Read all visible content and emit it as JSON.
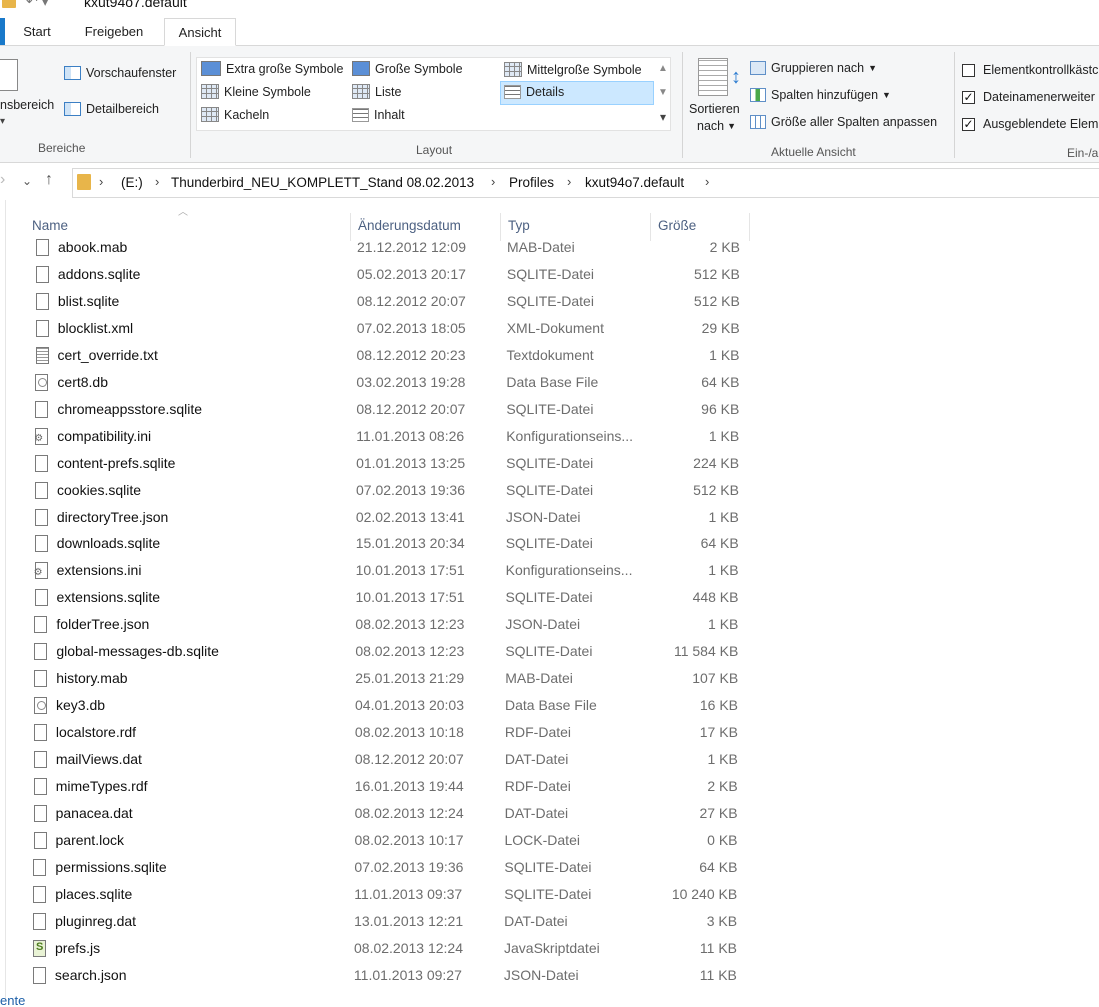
{
  "window": {
    "title": "kxut94o7.default",
    "quick_access": "↶  ▾"
  },
  "tabs": [
    {
      "label": "Start"
    },
    {
      "label": "Freigeben"
    },
    {
      "label": "Ansicht",
      "active": true
    }
  ],
  "ribbon": {
    "panes": {
      "nav_label": "nsbereich",
      "preview": "Vorschaufenster",
      "details": "Detailbereich",
      "group": "Bereiche"
    },
    "layout": {
      "items": [
        "Extra große Symbole",
        "Große Symbole",
        "Mittelgroße Symbole",
        "Kleine Symbole",
        "Liste",
        "Details",
        "Kacheln",
        "Inhalt"
      ],
      "selected": "Details",
      "group": "Layout"
    },
    "current_view": {
      "sort_line1": "Sortieren",
      "sort_line2": "nach",
      "group_by": "Gruppieren nach",
      "add_columns": "Spalten hinzufügen",
      "fit_columns": "Größe aller Spalten anpassen",
      "group": "Aktuelle Ansicht"
    },
    "show_hide": {
      "item_checkboxes": "Elementkontrollkästc",
      "file_extensions": "Dateinamenerweiter",
      "hidden_items": "Ausgeblendete Elem",
      "item_checkboxes_checked": false,
      "file_extensions_checked": true,
      "hidden_items_checked": true,
      "group": "Ein-/a"
    }
  },
  "address": {
    "crumbs": [
      "(E:)",
      "Thunderbird_NEU_KOMPLETT_Stand 08.02.2013",
      "Profiles",
      "kxut94o7.default"
    ]
  },
  "columns": {
    "name": "Name",
    "date": "Änderungsdatum",
    "type": "Typ",
    "size": "Größe"
  },
  "files": [
    {
      "name": "abook.mab",
      "date": "21.12.2012 12:09",
      "type": "MAB-Datei",
      "size": "2 KB",
      "icon": "file-icon"
    },
    {
      "name": "addons.sqlite",
      "date": "05.02.2013 20:17",
      "type": "SQLITE-Datei",
      "size": "512 KB",
      "icon": "file-icon"
    },
    {
      "name": "blist.sqlite",
      "date": "08.12.2012 20:07",
      "type": "SQLITE-Datei",
      "size": "512 KB",
      "icon": "file-icon"
    },
    {
      "name": "blocklist.xml",
      "date": "07.02.2013 18:05",
      "type": "XML-Dokument",
      "size": "29 KB",
      "icon": "file-icon"
    },
    {
      "name": "cert_override.txt",
      "date": "08.12.2012 20:23",
      "type": "Textdokument",
      "size": "1 KB",
      "icon": "text-file-icon"
    },
    {
      "name": "cert8.db",
      "date": "03.02.2013 19:28",
      "type": "Data Base File",
      "size": "64 KB",
      "icon": "database-file-icon"
    },
    {
      "name": "chromeappsstore.sqlite",
      "date": "08.12.2012 20:07",
      "type": "SQLITE-Datei",
      "size": "96 KB",
      "icon": "file-icon"
    },
    {
      "name": "compatibility.ini",
      "date": "11.01.2013 08:26",
      "type": "Konfigurationseins...",
      "size": "1 KB",
      "icon": "config-file-icon"
    },
    {
      "name": "content-prefs.sqlite",
      "date": "01.01.2013 13:25",
      "type": "SQLITE-Datei",
      "size": "224 KB",
      "icon": "file-icon"
    },
    {
      "name": "cookies.sqlite",
      "date": "07.02.2013 19:36",
      "type": "SQLITE-Datei",
      "size": "512 KB",
      "icon": "file-icon"
    },
    {
      "name": "directoryTree.json",
      "date": "02.02.2013 13:41",
      "type": "JSON-Datei",
      "size": "1 KB",
      "icon": "file-icon"
    },
    {
      "name": "downloads.sqlite",
      "date": "15.01.2013 20:34",
      "type": "SQLITE-Datei",
      "size": "64 KB",
      "icon": "file-icon"
    },
    {
      "name": "extensions.ini",
      "date": "10.01.2013 17:51",
      "type": "Konfigurationseins...",
      "size": "1 KB",
      "icon": "config-file-icon"
    },
    {
      "name": "extensions.sqlite",
      "date": "10.01.2013 17:51",
      "type": "SQLITE-Datei",
      "size": "448 KB",
      "icon": "file-icon"
    },
    {
      "name": "folderTree.json",
      "date": "08.02.2013 12:23",
      "type": "JSON-Datei",
      "size": "1 KB",
      "icon": "file-icon"
    },
    {
      "name": "global-messages-db.sqlite",
      "date": "08.02.2013 12:23",
      "type": "SQLITE-Datei",
      "size": "11 584 KB",
      "icon": "file-icon"
    },
    {
      "name": "history.mab",
      "date": "25.01.2013 21:29",
      "type": "MAB-Datei",
      "size": "107 KB",
      "icon": "file-icon"
    },
    {
      "name": "key3.db",
      "date": "04.01.2013 20:03",
      "type": "Data Base File",
      "size": "16 KB",
      "icon": "database-file-icon"
    },
    {
      "name": "localstore.rdf",
      "date": "08.02.2013 10:18",
      "type": "RDF-Datei",
      "size": "17 KB",
      "icon": "file-icon"
    },
    {
      "name": "mailViews.dat",
      "date": "08.12.2012 20:07",
      "type": "DAT-Datei",
      "size": "1 KB",
      "icon": "file-icon"
    },
    {
      "name": "mimeTypes.rdf",
      "date": "16.01.2013 19:44",
      "type": "RDF-Datei",
      "size": "2 KB",
      "icon": "file-icon"
    },
    {
      "name": "panacea.dat",
      "date": "08.02.2013 12:24",
      "type": "DAT-Datei",
      "size": "27 KB",
      "icon": "file-icon"
    },
    {
      "name": "parent.lock",
      "date": "08.02.2013 10:17",
      "type": "LOCK-Datei",
      "size": "0 KB",
      "icon": "file-icon"
    },
    {
      "name": "permissions.sqlite",
      "date": "07.02.2013 19:36",
      "type": "SQLITE-Datei",
      "size": "64 KB",
      "icon": "file-icon"
    },
    {
      "name": "places.sqlite",
      "date": "11.01.2013 09:37",
      "type": "SQLITE-Datei",
      "size": "10 240 KB",
      "icon": "file-icon"
    },
    {
      "name": "pluginreg.dat",
      "date": "13.01.2013 12:21",
      "type": "DAT-Datei",
      "size": "3 KB",
      "icon": "file-icon"
    },
    {
      "name": "prefs.js",
      "date": "08.02.2013 12:24",
      "type": "JavaSkriptdatei",
      "size": "11 KB",
      "icon": "javascript-file-icon"
    },
    {
      "name": "search.json",
      "date": "11.01.2013 09:27",
      "type": "JSON-Datei",
      "size": "11 KB",
      "icon": "file-icon"
    }
  ],
  "status": {
    "text": "ente"
  }
}
